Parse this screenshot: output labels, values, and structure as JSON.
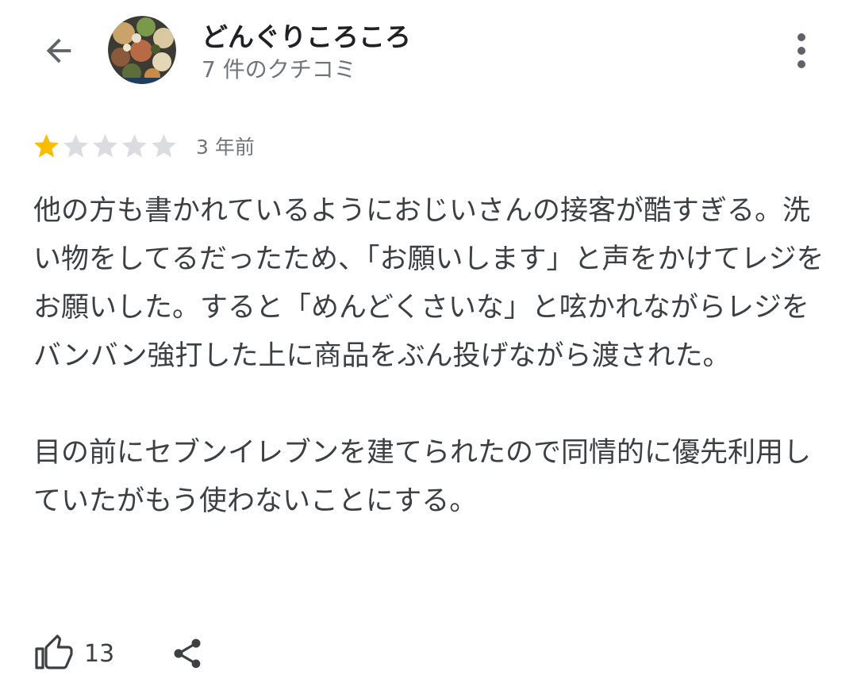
{
  "header": {
    "reviewer_name": "どんぐりころころ",
    "review_count": "7 件のクチコミ",
    "back_icon": "arrow-back-icon",
    "more_icon": "more-vert-icon"
  },
  "review": {
    "rating": 1,
    "max_rating": 5,
    "time": "3 年前",
    "paragraphs": [
      "他の方も書かれているようにおじいさんの接客が酷すぎる。洗い物をしてるだったため、「お願いします」と声をかけてレジをお願いした。すると「めんどくさいな」と呟かれながらレジをバンバン強打した上に商品をぶん投げながら渡された。",
      "目の前にセブンイレブンを建てられたので同情的に優先利用していたがもう使わないことにする。"
    ]
  },
  "actions": {
    "like_count": "13",
    "like_icon": "thumb-up-icon",
    "share_icon": "share-icon"
  },
  "colors": {
    "star_filled": "#fbbc04",
    "star_empty": "#dadce0",
    "text_primary": "#202124",
    "text_secondary": "#70757a"
  }
}
